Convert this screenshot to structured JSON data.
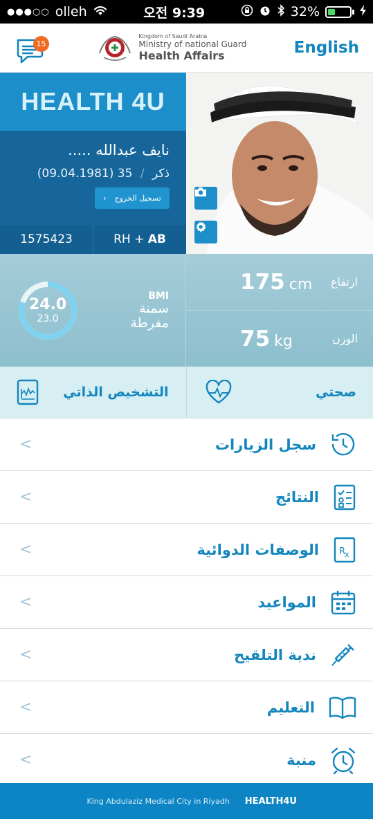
{
  "status_bar": {
    "carrier": "olleh",
    "time": "오전 9:39",
    "battery": "32%",
    "battery_level": 0.32
  },
  "header": {
    "messages_count": "15",
    "org_line1": "Kingdom of Saudi Arabia",
    "org_line2": "Ministry of national Guard",
    "org_line3": "Health Affairs",
    "language_button": "English"
  },
  "profile": {
    "app_logo": "HEALTH 4U",
    "name": "نايف عبدالله .....",
    "gender": "ذكر",
    "age_dob": "35 (09.04.1981)",
    "logout_label": "تسجيل الخروج",
    "mrn": "1575423",
    "blood_rh": "RH +",
    "blood_type": "AB"
  },
  "vitals": {
    "bmi_label": "BMI",
    "bmi_value": "24.0",
    "bmi_prev": "23.0",
    "bmi_ring_fraction": 0.8,
    "bmi_class": "سمنة مفرطة",
    "height_value": "175",
    "height_unit": "cm",
    "height_label": "ارتفاع",
    "weight_value": "75",
    "weight_unit": "kg",
    "weight_label": "الوزن"
  },
  "quick": {
    "self_diagnosis": "التشخيص الذاتي",
    "my_health": "صحتي"
  },
  "menu": [
    {
      "label": "سجل الزيارات",
      "icon": "visit-history-icon"
    },
    {
      "label": "النتائج",
      "icon": "results-checklist-icon"
    },
    {
      "label": "الوصفات الدوائية",
      "icon": "prescription-rx-icon"
    },
    {
      "label": "المواعيد",
      "icon": "calendar-icon"
    },
    {
      "label": "ندبة التلقيح",
      "icon": "syringe-icon"
    },
    {
      "label": "التعليم",
      "icon": "book-icon"
    },
    {
      "label": "منبة",
      "icon": "alarm-clock-icon"
    }
  ],
  "footer": {
    "location": "King Abdulaziz Medical City in Riyadh",
    "app_name": "HEALTH4U"
  },
  "colors": {
    "primary": "#1386bd",
    "dark_blue": "#16669c",
    "badge": "#f06a23",
    "quick_bg": "#d7eef3"
  }
}
